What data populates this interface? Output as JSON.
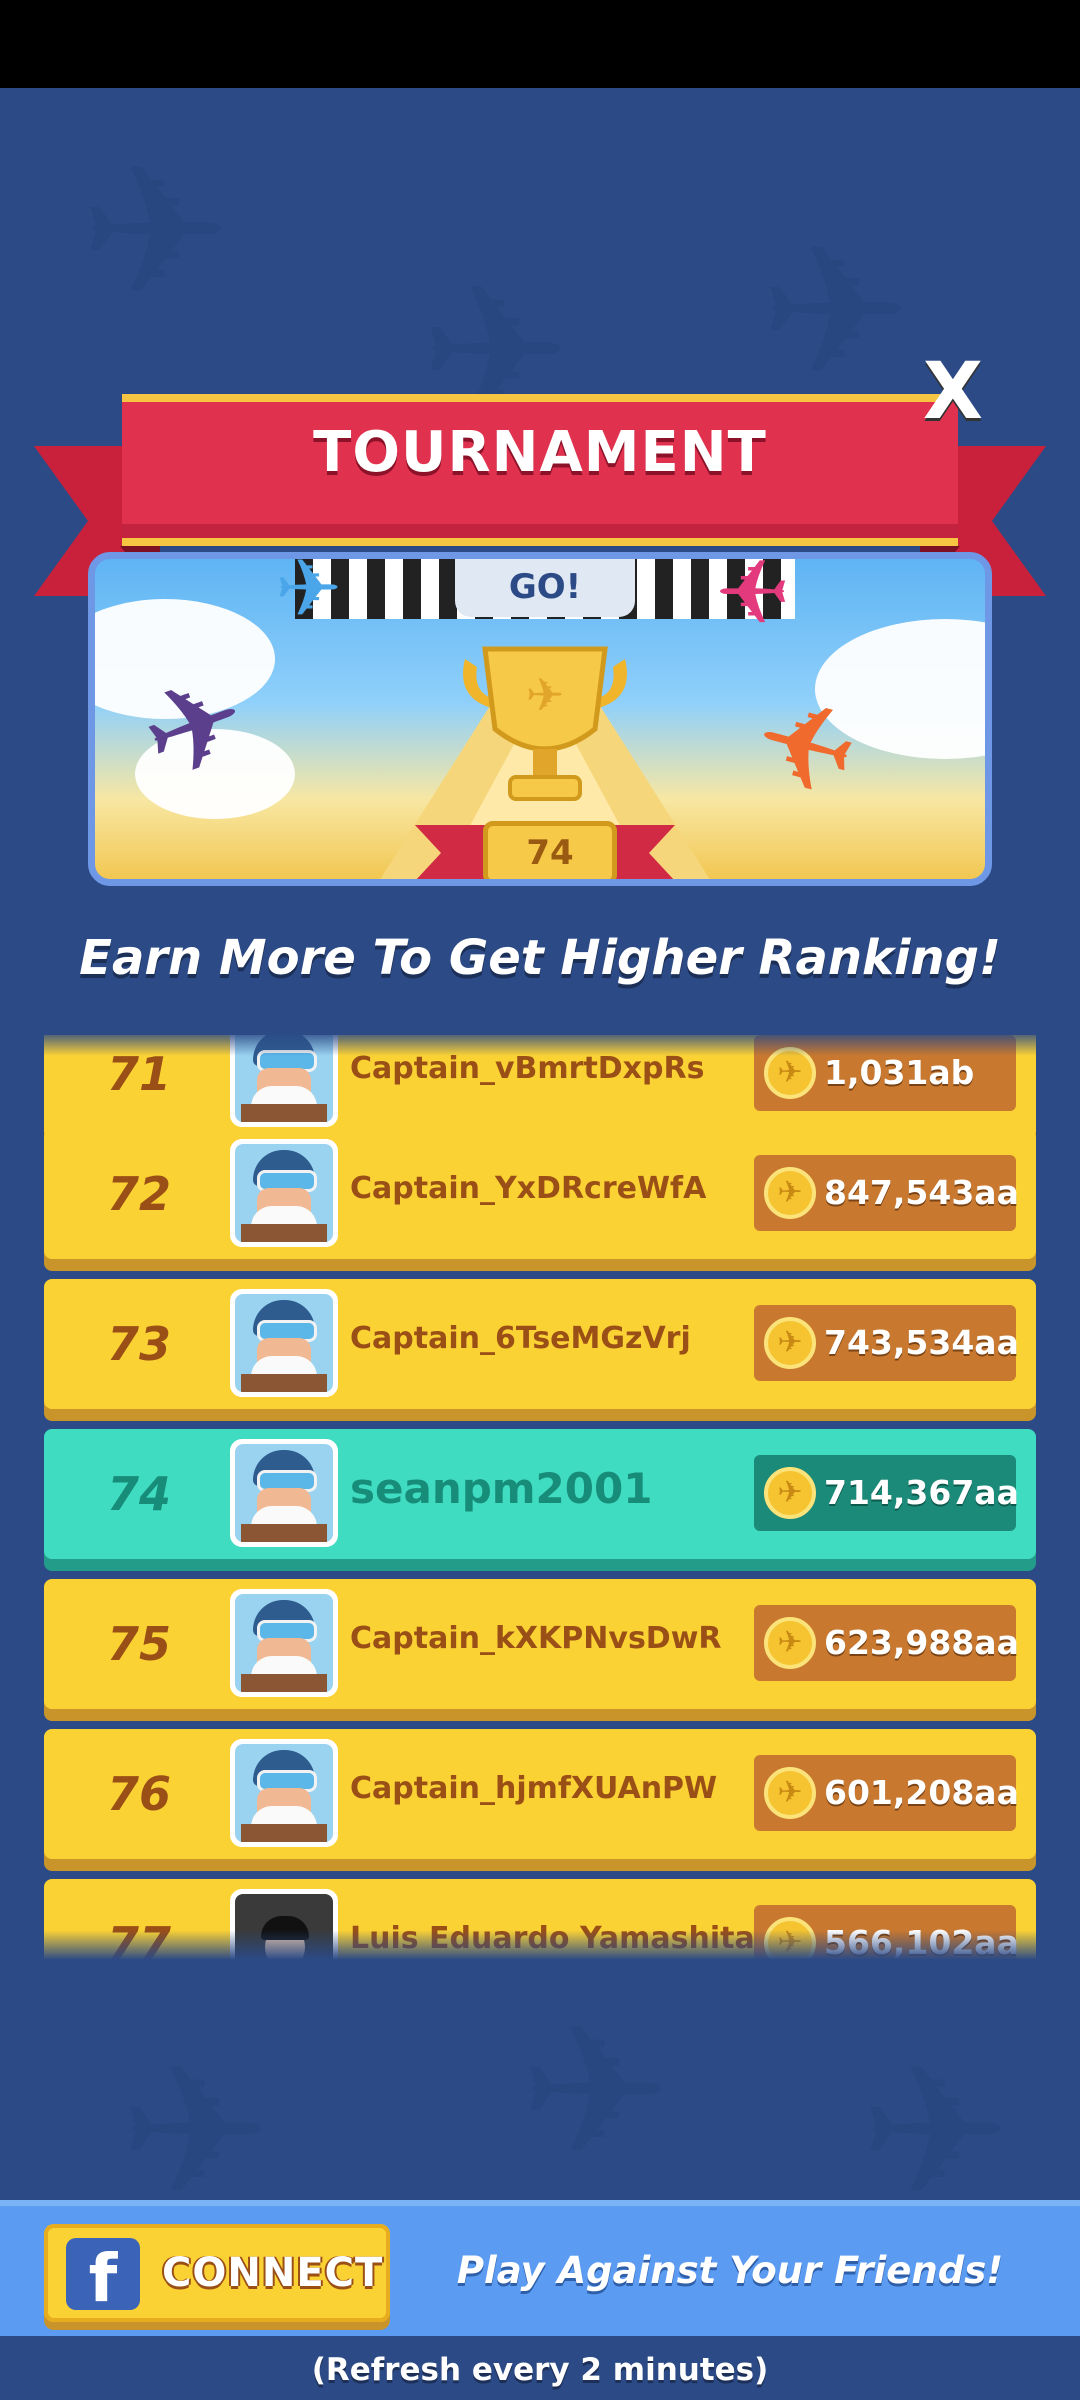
{
  "popup": {
    "title": "TOURNAMENT",
    "close_label": "X",
    "banner_sign": "GO!",
    "trophy_rank": "74",
    "subtitle": "Earn More To Get Higher Ranking!"
  },
  "leaderboard": {
    "rows": [
      {
        "rank": "71",
        "name": "Captain_vBmrtDxpRs",
        "score": "1,031ab",
        "is_me": false,
        "avatar": "captain-avatar"
      },
      {
        "rank": "72",
        "name": "Captain_YxDRcreWfA",
        "score": "847,543aa",
        "is_me": false,
        "avatar": "captain-avatar"
      },
      {
        "rank": "73",
        "name": "Captain_6TseMGzVrj",
        "score": "743,534aa",
        "is_me": false,
        "avatar": "captain-avatar"
      },
      {
        "rank": "74",
        "name": "seanpm2001",
        "score": "714,367aa",
        "is_me": true,
        "avatar": "captain-avatar"
      },
      {
        "rank": "75",
        "name": "Captain_kXKPNvsDwR",
        "score": "623,988aa",
        "is_me": false,
        "avatar": "captain-avatar"
      },
      {
        "rank": "76",
        "name": "Captain_hjmfXUAnPW",
        "score": "601,208aa",
        "is_me": false,
        "avatar": "captain-avatar"
      },
      {
        "rank": "77",
        "name": "Luis Eduardo Yamashita",
        "score": "566,102aa",
        "is_me": false,
        "avatar": "photo-avatar"
      }
    ]
  },
  "footer": {
    "connect_label": "CONNECT",
    "facebook_icon": "facebook-icon",
    "friends_text": "Play Against Your Friends!",
    "refresh_text": "(Refresh every 2 minutes)"
  },
  "colors": {
    "background": "#2b4a86",
    "row_default": "#fbd234",
    "row_me": "#3fdcc2",
    "ribbon": "#e0324f",
    "footer_bar": "#5b9cf2"
  }
}
